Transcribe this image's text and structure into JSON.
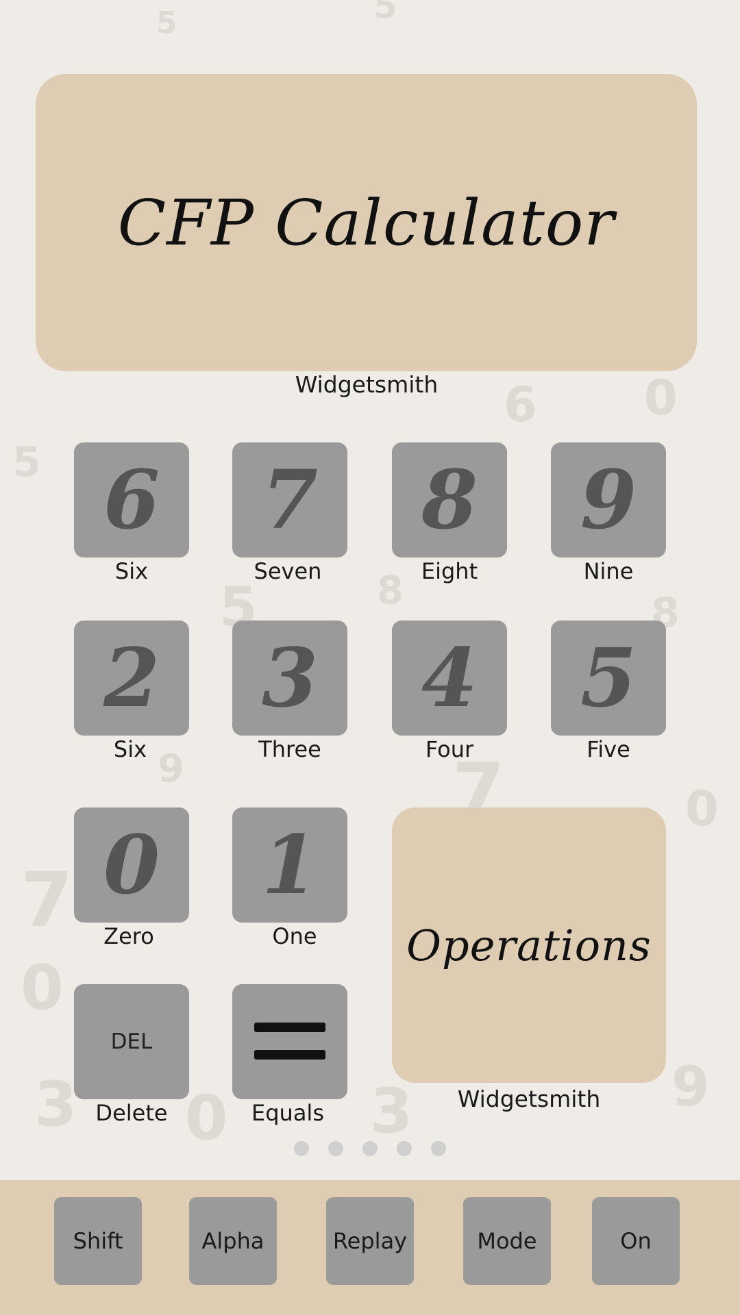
{
  "colors": {
    "background": "#efece8",
    "widget": "#dfcdb3",
    "tile": "#9a9a9a",
    "glyph": "#555555"
  },
  "top_widget": {
    "title": "CFP Calculator",
    "caption": "Widgetsmith"
  },
  "ops_widget": {
    "title": "Operations",
    "caption": "Widgetsmith"
  },
  "apps": [
    {
      "glyph": "6",
      "label": "Six"
    },
    {
      "glyph": "7",
      "label": "Seven"
    },
    {
      "glyph": "8",
      "label": "Eight"
    },
    {
      "glyph": "9",
      "label": "Nine"
    },
    {
      "glyph": "2",
      "label": "Six"
    },
    {
      "glyph": "3",
      "label": "Three"
    },
    {
      "glyph": "4",
      "label": "Four"
    },
    {
      "glyph": "5",
      "label": "Five"
    },
    {
      "glyph": "0",
      "label": "Zero"
    },
    {
      "glyph": "1",
      "label": "One"
    },
    {
      "glyph": "DEL",
      "label": "Delete"
    },
    {
      "glyph": "equals-icon",
      "label": "Equals"
    }
  ],
  "page_indicator": {
    "pages": 5
  },
  "dock": [
    "Shift",
    "Alpha",
    "Replay",
    "Mode",
    "On"
  ]
}
